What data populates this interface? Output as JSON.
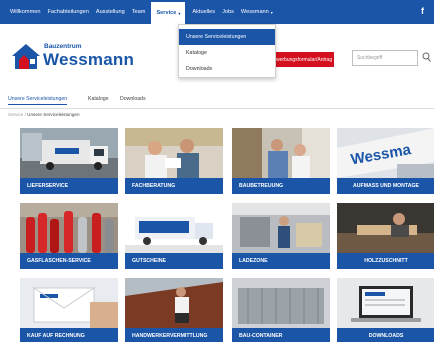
{
  "topnav": {
    "items": [
      "Willkommen",
      "Fachabteilungen",
      "Ausstellung",
      "Team",
      "Service",
      "Aktuelles",
      "Jobs",
      "Wessmann"
    ],
    "active_index": 4,
    "facebook": "f",
    "accent": "#1a55a8"
  },
  "dropdown": {
    "items": [
      "Unsere Serviceleistungen",
      "Kataloge",
      "Downloads"
    ]
  },
  "header": {
    "logo_top": "Bauzentrum",
    "logo_main": "Wessmann",
    "red_button": "Bewerbungsformular/Antrag",
    "search_placeholder": "Suchbegriff"
  },
  "tabs": [
    "Unsere Serviceleistungen",
    "Kataloge",
    "Downloads"
  ],
  "breadcrumb": {
    "first": "Service",
    "sep": "/",
    "current": "Unsere Serviceleistungen"
  },
  "tiles": [
    {
      "label": "LIEFERSERVICE"
    },
    {
      "label": "FACHBERATUNG"
    },
    {
      "label": "BAUBETREUUNG"
    },
    {
      "label": "AUFMASS UND MONTAGE"
    },
    {
      "label": "GASFLASCHEN-SERVICE"
    },
    {
      "label": "GUTSCHEINE"
    },
    {
      "label": "LADEZONE"
    },
    {
      "label": "HOLZZUSCHNITT"
    },
    {
      "label": "KAUF AUF RECHNUNG"
    },
    {
      "label": "HANDWERKERVERMITTLUNG"
    },
    {
      "label": "BAU-CONTAINER"
    },
    {
      "label": "DOWNLOADS"
    }
  ]
}
